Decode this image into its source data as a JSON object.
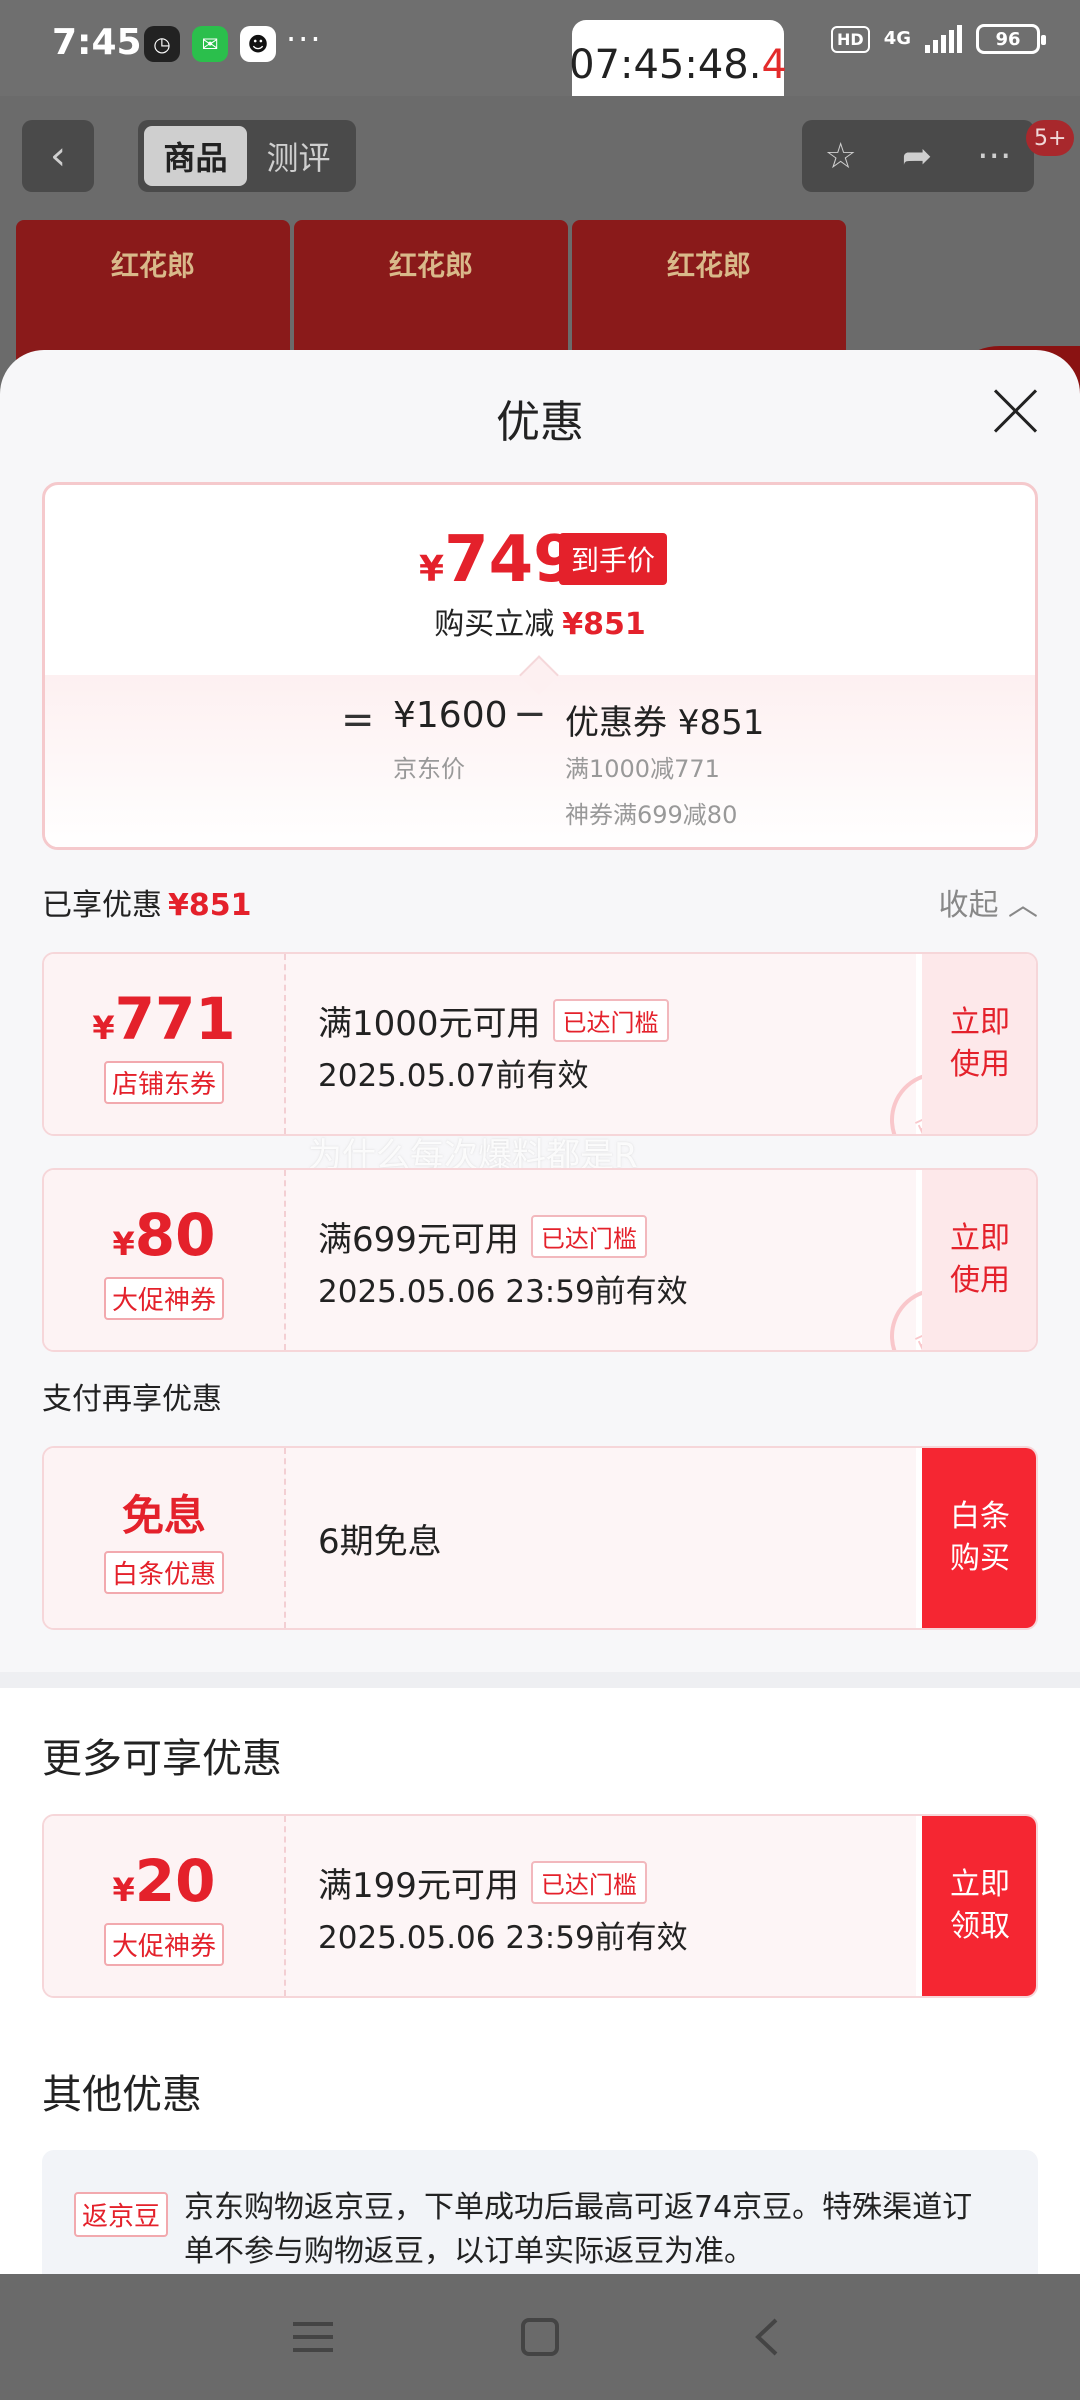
{
  "status": {
    "time": "7:45",
    "clock": "07:45:48.",
    "clock_tenth": "4",
    "hd": "HD",
    "net": "4G",
    "battery": "96",
    "more": "···"
  },
  "header": {
    "tab_goods": "商品",
    "tab_review": "测评",
    "badge": "5+",
    "box_label": "红花郎"
  },
  "sheet": {
    "title": "优惠",
    "summary": {
      "yen": "¥",
      "final_price": "749",
      "final_tag": "到手价",
      "reduce_label": "购买立减",
      "reduce_value": "¥851",
      "eq": "=",
      "jd_price": "¥1600",
      "jd_label": "京东价",
      "minus": "−",
      "coupon_total": "优惠券 ¥851",
      "coupon_detail_1": "满1000减771",
      "coupon_detail_2": "神券满699减80"
    },
    "enjoyed": {
      "label": "已享优惠",
      "value": "¥851",
      "collapse": "收起 ︿"
    },
    "coupons": [
      {
        "yen": "¥",
        "amount": "771",
        "tag": "店铺东券",
        "condition": "满1000元可用",
        "reached": "已达门槛",
        "date": "2025.05.07前有效",
        "action_1": "立即",
        "action_2": "使用",
        "stamp": "已领"
      },
      {
        "yen": "¥",
        "amount": "80",
        "tag": "大促神券",
        "condition": "满699元可用",
        "reached": "已达门槛",
        "date": "2025.05.06 23:59前有效",
        "action_1": "立即",
        "action_2": "使用",
        "stamp": "已领"
      }
    ],
    "watermark": "为什么每次爆料都是R",
    "pay_section": "支付再享优惠",
    "pay_coupon": {
      "title": "免息",
      "tag": "白条优惠",
      "line": "6期免息",
      "action_1": "白条",
      "action_2": "购买"
    },
    "more_section": "更多可享优惠",
    "more_coupon": {
      "yen": "¥",
      "amount": "20",
      "tag": "大促神券",
      "condition": "满199元可用",
      "reached": "已达门槛",
      "date": "2025.05.06 23:59前有效",
      "action_1": "立即",
      "action_2": "领取"
    },
    "other_section": "其他优惠",
    "other": {
      "tag": "返京豆",
      "text": "京东购物返京豆，下单成功后最高可返74京豆。特殊渠道订单不参与购物返豆，以订单实际返豆为准。"
    }
  },
  "colors": {
    "accent_red": "#e4212b",
    "action_red": "#f52632"
  }
}
